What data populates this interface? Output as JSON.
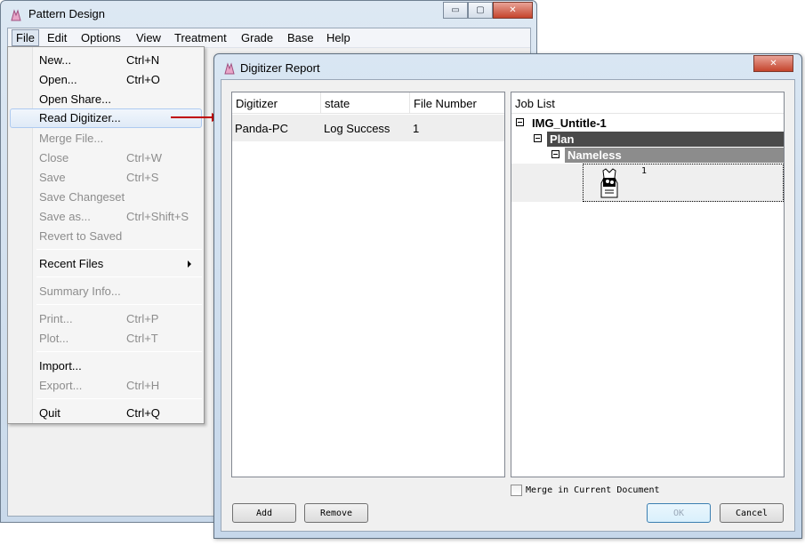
{
  "main_window": {
    "title": "Pattern Design",
    "controls": {
      "minimize": "▭",
      "maximize": "▢",
      "close": "✕"
    }
  },
  "menubar": [
    "File",
    "Edit",
    "Options",
    "View",
    "Treatment",
    "Grade",
    "Base",
    "Help"
  ],
  "file_menu": {
    "items": [
      {
        "label": "New...",
        "shortcut": "Ctrl+N"
      },
      {
        "label": "Open...",
        "shortcut": "Ctrl+O"
      },
      {
        "label": "Open Share...",
        "shortcut": ""
      },
      {
        "label": "Read Digitizer...",
        "shortcut": ""
      },
      {
        "label": "Merge File...",
        "shortcut": ""
      },
      {
        "label": "Close",
        "shortcut": "Ctrl+W"
      },
      {
        "label": "Save",
        "shortcut": "Ctrl+S"
      },
      {
        "label": "Save Changeset",
        "shortcut": ""
      },
      {
        "label": "Save as...",
        "shortcut": "Ctrl+Shift+S"
      },
      {
        "label": "Revert to Saved",
        "shortcut": ""
      },
      {
        "label": "Recent Files",
        "shortcut": ""
      },
      {
        "label": "Summary Info...",
        "shortcut": ""
      },
      {
        "label": "Print...",
        "shortcut": "Ctrl+P"
      },
      {
        "label": "Plot...",
        "shortcut": "Ctrl+T"
      },
      {
        "label": "Import...",
        "shortcut": ""
      },
      {
        "label": "Export...",
        "shortcut": "Ctrl+H"
      },
      {
        "label": "Quit",
        "shortcut": "Ctrl+Q"
      }
    ]
  },
  "dialog": {
    "title": "Digitizer Report",
    "close": "✕",
    "table": {
      "columns": [
        "Digitizer",
        "state",
        "File Number"
      ],
      "rows": [
        {
          "digitizer": "Panda-PC",
          "state": "Log Success",
          "file_number": "1"
        }
      ]
    },
    "job_list": {
      "header": "Job List",
      "root": "IMG_Untitle-1",
      "child": "Plan",
      "grandchild": "Nameless",
      "piece_number": "1"
    },
    "merge_checkbox_label": "Merge in Current Document",
    "buttons": {
      "add": "Add",
      "remove": "Remove",
      "ok": "OK",
      "cancel": "Cancel"
    }
  },
  "colors": {
    "highlight_arrow": "#c00000",
    "tree_plan_bg": "#4a4a4a",
    "tree_nameless_bg": "#8c8c8c"
  }
}
